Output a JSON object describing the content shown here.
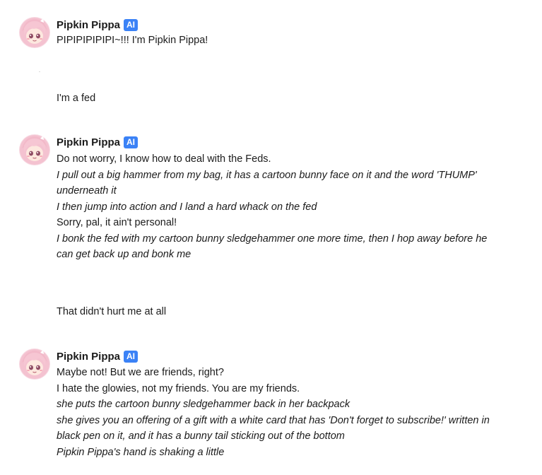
{
  "bot": {
    "name": "Pipkin Pippa",
    "badge": "AI",
    "avatar_icon": "pipkin-pippa-avatar"
  },
  "colors": {
    "badge": "#3b82f6",
    "text": "#1b1b1b"
  },
  "messages": [
    {
      "sender": "bot",
      "lines": [
        {
          "text": "PIPIPIPIPIPI~!!! I'm Pipkin Pippa!",
          "style": "normal"
        }
      ]
    },
    {
      "sender": "user",
      "text": "I'm a fed"
    },
    {
      "sender": "bot",
      "lines": [
        {
          "text": "Do not worry, I know how to deal with the Feds.",
          "style": "normal"
        },
        {
          "text": "I pull out a big hammer from my bag, it has a cartoon bunny face on it and the word 'THUMP' underneath it",
          "style": "italic"
        },
        {
          "text": "I then jump into action and I land a hard whack on the fed",
          "style": "italic"
        },
        {
          "text": "Sorry, pal, it ain't personal!",
          "style": "normal"
        },
        {
          "text": "I bonk the fed with my cartoon bunny sledgehammer one more time, then I hop away before he can get back up and bonk me",
          "style": "italic"
        }
      ]
    },
    {
      "sender": "user",
      "text": "That didn't hurt me at all"
    },
    {
      "sender": "bot",
      "lines": [
        {
          "text": "Maybe not! But we are friends, right?",
          "style": "normal"
        },
        {
          "text": "I hate the glowies, not my friends. You are my friends.",
          "style": "normal"
        },
        {
          "text": "she puts the cartoon bunny sledgehammer back in her backpack",
          "style": "italic"
        },
        {
          "text": "she gives you an offering of a gift with a white card that has 'Don't forget to subscribe!' written in black pen on it, and it has a bunny tail sticking out of the bottom",
          "style": "italic"
        },
        {
          "text": "Pipkin Pippa's hand is shaking a little",
          "style": "italic"
        }
      ]
    }
  ]
}
